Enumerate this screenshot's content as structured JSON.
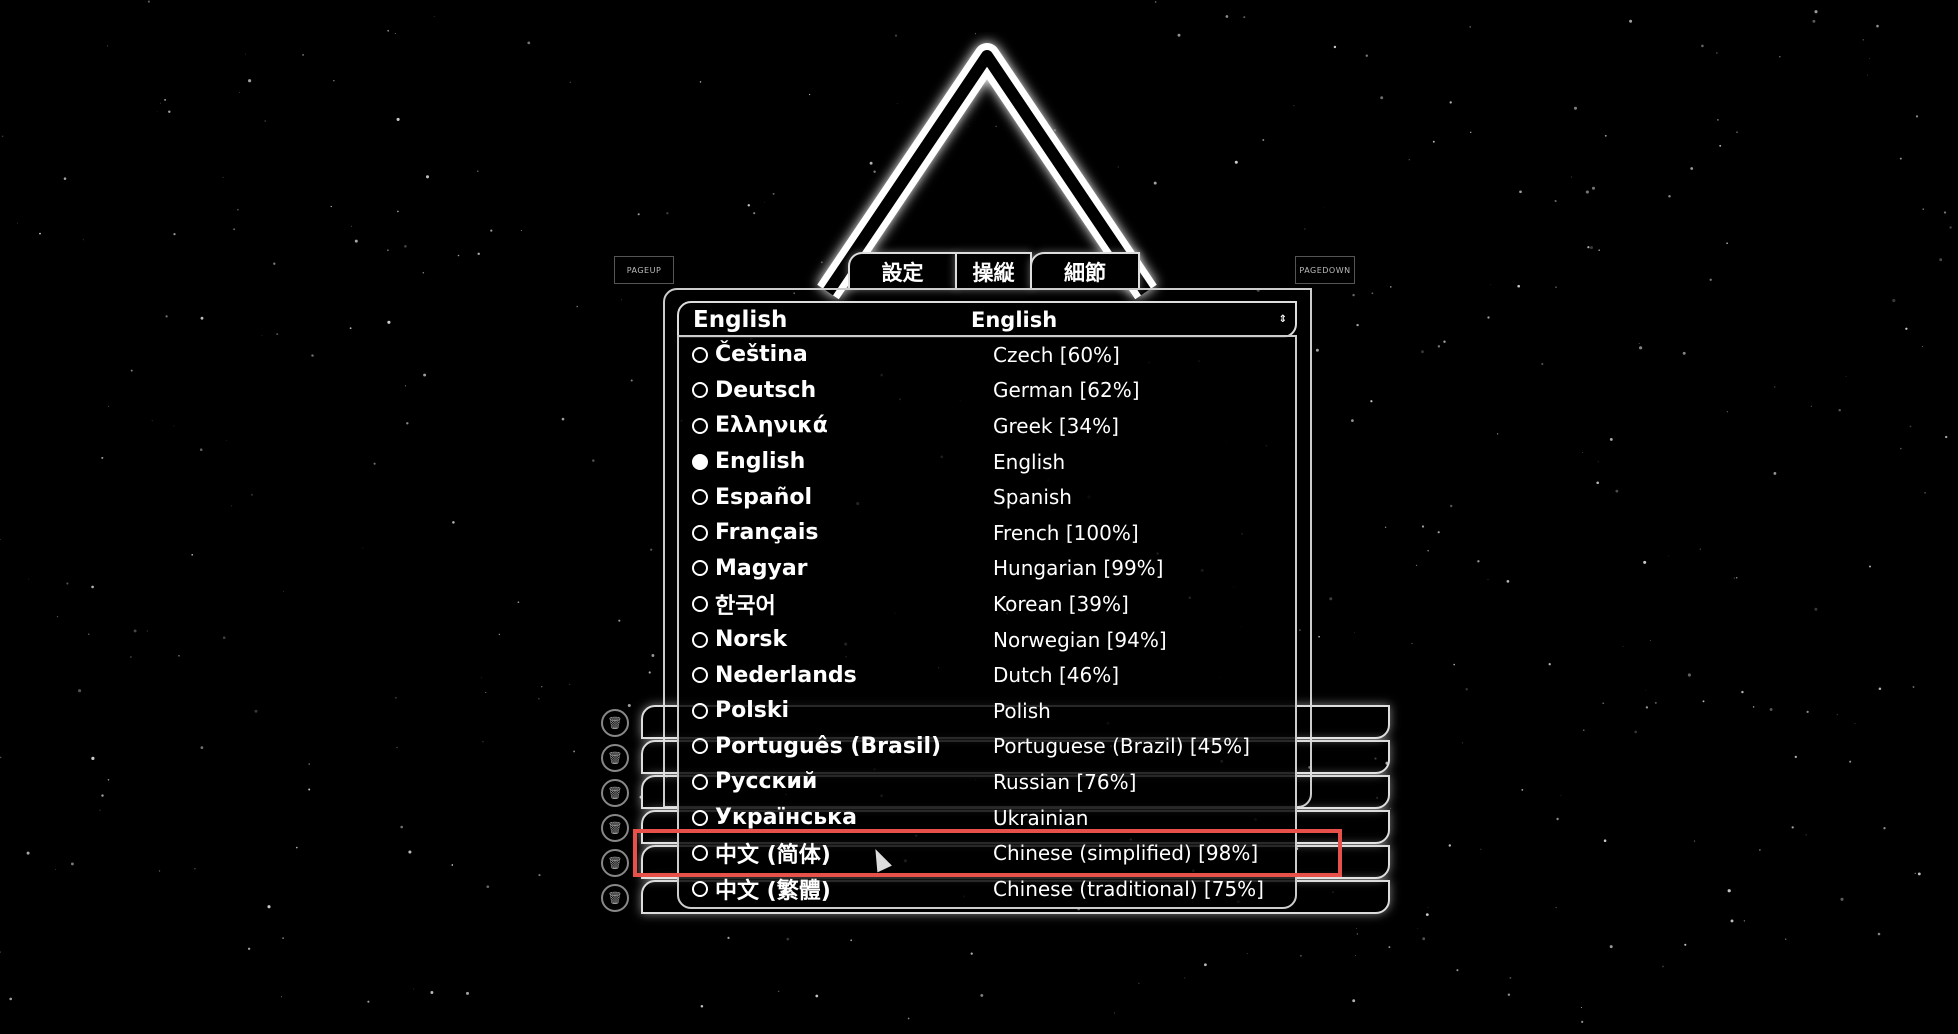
{
  "top_buttons": {
    "pageup": "PAGEUP",
    "pagedown": "PAGEDOWN"
  },
  "tabs": [
    {
      "label": "設定",
      "active": true
    },
    {
      "label": "操縦"
    },
    {
      "label": "細節"
    }
  ],
  "language_select": {
    "selected_native": "English",
    "selected_english": "English"
  },
  "languages": [
    {
      "native": "Čeština",
      "english": "Czech [60%]"
    },
    {
      "native": "Deutsch",
      "english": "German [62%]"
    },
    {
      "native": "Ελληνικά",
      "english": "Greek [34%]"
    },
    {
      "native": "English",
      "english": "English",
      "selected": true
    },
    {
      "native": "Español",
      "english": "Spanish"
    },
    {
      "native": "Français",
      "english": "French [100%]"
    },
    {
      "native": "Magyar",
      "english": "Hungarian [99%]"
    },
    {
      "native": "한국어",
      "english": "Korean [39%]"
    },
    {
      "native": "Norsk",
      "english": "Norwegian [94%]"
    },
    {
      "native": "Nederlands",
      "english": "Dutch [46%]"
    },
    {
      "native": "Polski",
      "english": "Polish"
    },
    {
      "native": "Português (Brasil)",
      "english": "Portuguese (Brazil) [45%]"
    },
    {
      "native": "Русский",
      "english": "Russian [76%]"
    },
    {
      "native": "Українська",
      "english": "Ukrainian"
    },
    {
      "native": "中文 (简体)",
      "english": "Chinese (simplified) [98%]",
      "highlighted": true
    },
    {
      "native": "中文 (繁體)",
      "english": "Chinese (traditional) [75%]"
    }
  ],
  "colors": {
    "background": "#000000",
    "outline": "#dddddd",
    "highlight": "#e8504a"
  }
}
